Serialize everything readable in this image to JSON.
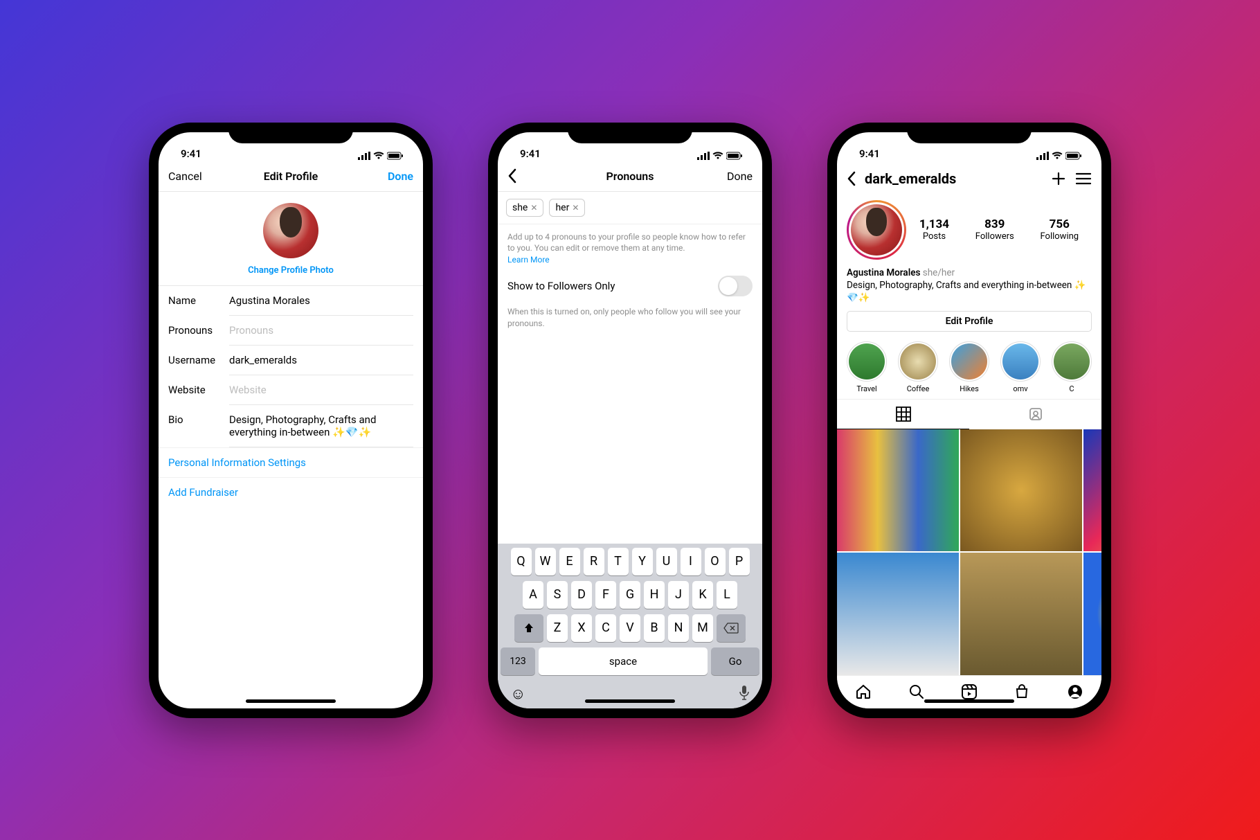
{
  "status": {
    "time": "9:41"
  },
  "phone1": {
    "nav": {
      "cancel": "Cancel",
      "title": "Edit Profile",
      "done": "Done"
    },
    "change_photo": "Change Profile Photo",
    "fields": {
      "name_label": "Name",
      "name_value": "Agustina Morales",
      "pronouns_label": "Pronouns",
      "pronouns_placeholder": "Pronouns",
      "username_label": "Username",
      "username_value": "dark_emeralds",
      "website_label": "Website",
      "website_placeholder": "Website",
      "bio_label": "Bio",
      "bio_value": "Design, Photography, Crafts and everything in-between ✨💎✨"
    },
    "links": {
      "personal": "Personal Information Settings",
      "fundraiser": "Add Fundraiser"
    }
  },
  "phone2": {
    "nav": {
      "title": "Pronouns",
      "done": "Done"
    },
    "chips": [
      "she",
      "her"
    ],
    "helper_text": "Add up to 4 pronouns to your profile so people know how to refer to you. You can edit or remove them at any time.",
    "learn_more": "Learn More",
    "toggle_label": "Show to Followers Only",
    "toggle_help": "When this is turned on, only people who follow you will see your pronouns.",
    "keyboard": {
      "rows": [
        [
          "Q",
          "W",
          "E",
          "R",
          "T",
          "Y",
          "U",
          "I",
          "O",
          "P"
        ],
        [
          "A",
          "S",
          "D",
          "F",
          "G",
          "H",
          "J",
          "K",
          "L"
        ],
        [
          "Z",
          "X",
          "C",
          "V",
          "B",
          "N",
          "M"
        ]
      ],
      "num": "123",
      "space": "space",
      "go": "Go"
    }
  },
  "phone3": {
    "username": "dark_emeralds",
    "stats": {
      "posts_n": "1,134",
      "posts_l": "Posts",
      "followers_n": "839",
      "followers_l": "Followers",
      "following_n": "756",
      "following_l": "Following"
    },
    "bio": {
      "name": "Agustina Morales",
      "pronouns": "she/her",
      "text": "Design, Photography, Crafts and everything in-between ✨💎✨"
    },
    "edit_profile": "Edit Profile",
    "highlights": [
      {
        "label": "Travel",
        "bg": "linear-gradient(#4fa34f,#2e7a2e)"
      },
      {
        "label": "Coffee",
        "bg": "radial-gradient(circle,#e8dcb0,#9b8248)"
      },
      {
        "label": "Hikes",
        "bg": "linear-gradient(135deg,#3aa0e0,#f08030)"
      },
      {
        "label": "omv",
        "bg": "linear-gradient(#6ab8ea,#3a80c0)"
      },
      {
        "label": "C",
        "bg": "linear-gradient(#7aa860,#4e7a3a)"
      }
    ],
    "grid_colors": [
      "linear-gradient(90deg,#d83a6a,#e8c040,#3a68c8,#30a858)",
      "radial-gradient(circle,#d8a840,#7a5820)",
      "linear-gradient(135deg,#1838b8,#e82858,#f0c830)",
      "linear-gradient(#3a88d0,#e8e8e8)",
      "linear-gradient(#b89858,#6a5a30)",
      "radial-gradient(circle,#2868e0 30%,#e0d040 32%,#2868e0 55%)"
    ]
  }
}
